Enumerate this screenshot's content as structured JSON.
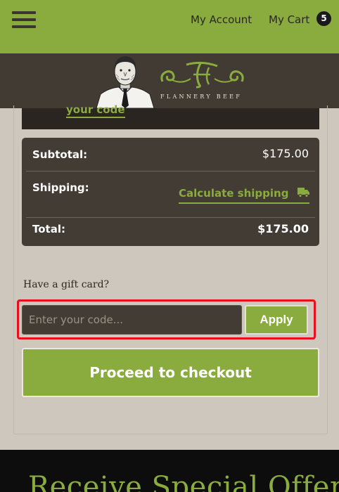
{
  "header": {
    "account_label": "My Account",
    "cart_label": "My Cart",
    "cart_count": "5",
    "menu_icon": "hamburger-menu-icon"
  },
  "brand": {
    "name": "FLANNERY BEEF",
    "mascot_icon": "butcher-mascot-icon",
    "monogram_icon": "flannery-monogram-icon",
    "accent_color": "#8aac3e"
  },
  "promo": {
    "link_label": "your code"
  },
  "totals": {
    "subtotal_label": "Subtotal:",
    "subtotal_value": "$175.00",
    "shipping_label": "Shipping:",
    "shipping_link": "Calculate shipping",
    "shipping_icon": "truck-icon",
    "total_label": "Total:",
    "total_value": "$175.00"
  },
  "gift_card": {
    "prompt": "Have a gift card?",
    "input_placeholder": "Enter your code...",
    "input_value": "",
    "apply_label": "Apply"
  },
  "checkout": {
    "button_label": "Proceed to checkout"
  },
  "footer": {
    "heading": "Receive Special Offers"
  }
}
